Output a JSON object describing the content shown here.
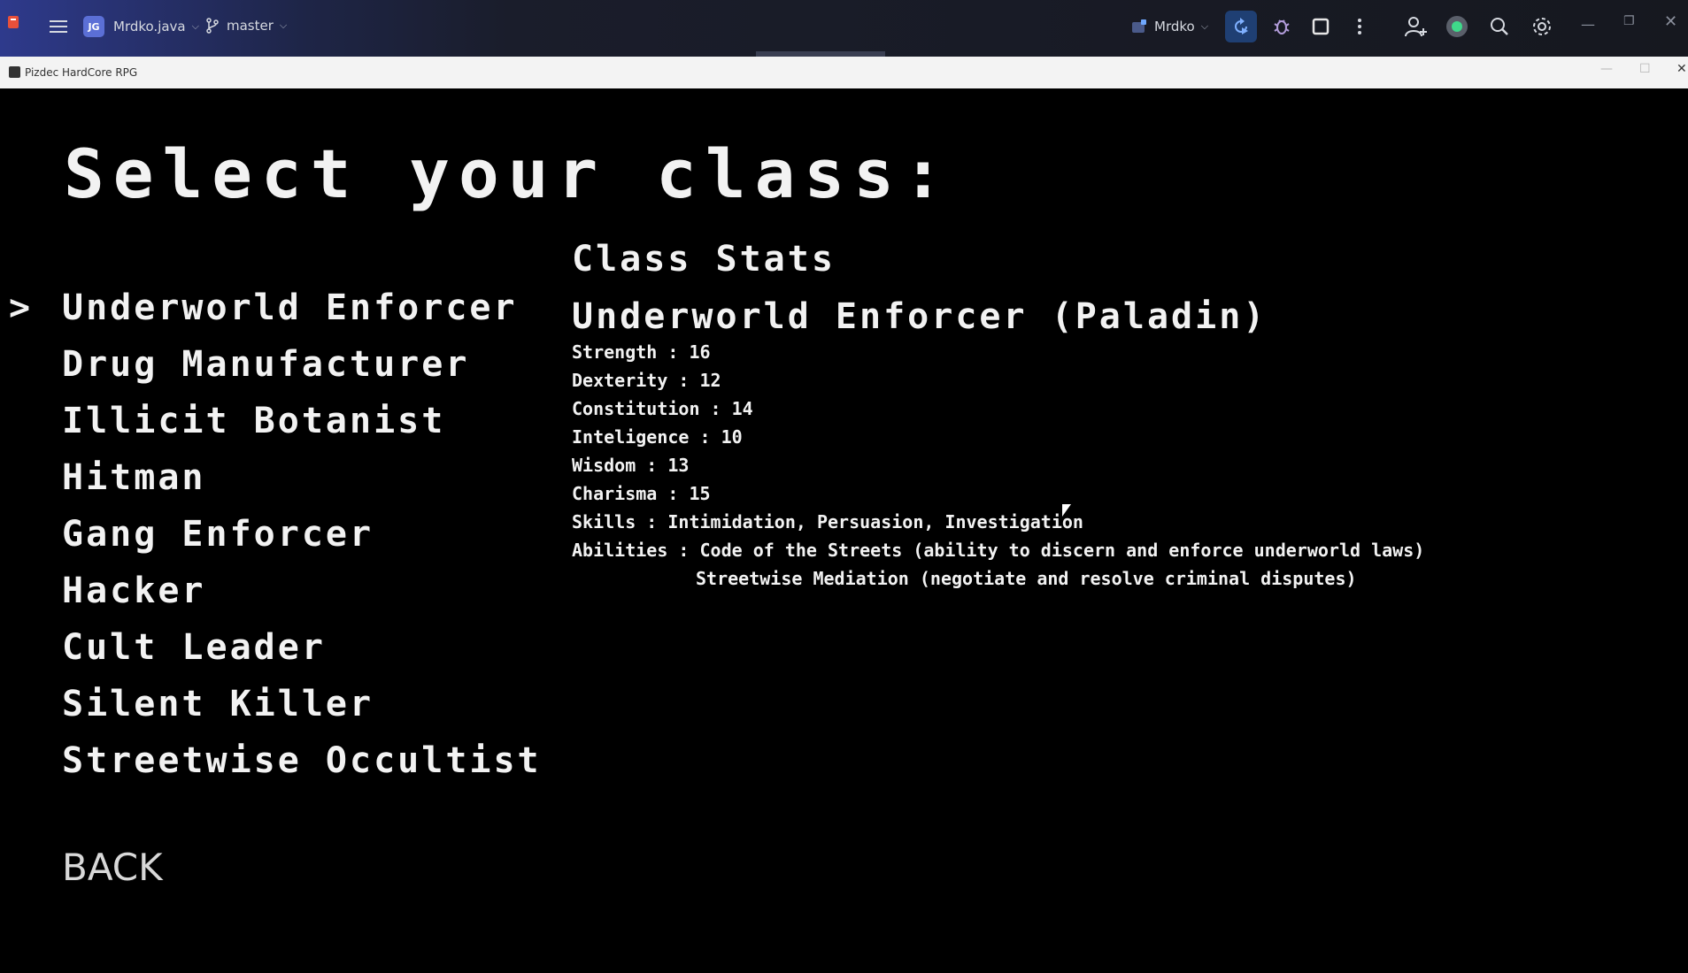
{
  "ide": {
    "project_badge": "JG",
    "project_name": "Mrdko.java",
    "branch": "master",
    "run_config": "Mrdko"
  },
  "window": {
    "title": "Pizdec HardCore RPG"
  },
  "game": {
    "heading": "Select your class:",
    "cursor_glyph": ">",
    "selected_index": 0,
    "classes": [
      "Underworld Enforcer",
      "Drug Manufacturer",
      "Illicit Botanist",
      "Hitman",
      "Gang Enforcer",
      "Hacker",
      "Cult Leader",
      "Silent Killer",
      "Streetwise Occultist"
    ],
    "back_label": "BACK",
    "stats": {
      "title": "Class Stats",
      "class_name": "Underworld Enforcer (Paladin)",
      "lines": [
        "Strength : 16",
        "Dexterity : 12",
        "Constitution : 14",
        "Inteligence : 10",
        "Wisdom : 13",
        "Charisma : 15",
        "Skills : Intimidation, Persuasion, Investigation",
        "Abilities : Code of the Streets (ability to discern and enforce underworld laws)"
      ],
      "ability_continuation": "Streetwise Mediation (negotiate and resolve criminal disputes)"
    }
  },
  "colors": {
    "background": "#000000",
    "text": "#f2f2f2",
    "ide_accent": "#1f3f73"
  }
}
